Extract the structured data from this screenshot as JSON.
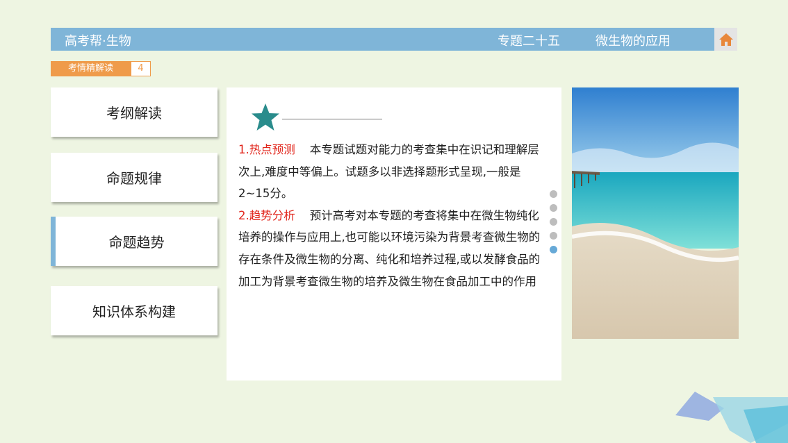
{
  "header": {
    "brand": "高考帮·生物",
    "chapter": "专题二十五",
    "chapter_title": "微生物的应用",
    "home_icon": "home-icon"
  },
  "tag": {
    "label": "考情精解读",
    "page": "4"
  },
  "menu": {
    "items": [
      {
        "label": "考纲解读"
      },
      {
        "label": "命题规律"
      },
      {
        "label": "命题趋势",
        "active": true
      },
      {
        "label": "知识体系构建"
      }
    ]
  },
  "content": {
    "icon": "star-icon",
    "p1_head": "1.热点预测",
    "p1_body": "本专题试题对能力的考查集中在识记和理解层次上,难度中等偏上。试题多以非选择题形式呈现,一般是2~15分。",
    "p2_head": "2.趋势分析",
    "p2_body": "预计高考对本专题的考查将集中在微生物纯化培养的操作与应用上,也可能以环境污染为背景考查微生物的存在条件及微生物的分离、纯化和培养过程,或以发酵食品的加工为背景考查微生物的培养及微生物在食品加工中的作用"
  },
  "pager": {
    "count": 5,
    "active_index": 4
  },
  "colors": {
    "header_bg": "#7fb5d8",
    "accent_orange": "#ef9b4a",
    "highlight_red": "#e1251b",
    "star_teal": "#2a8c8c",
    "home_orange": "#e8873a"
  }
}
